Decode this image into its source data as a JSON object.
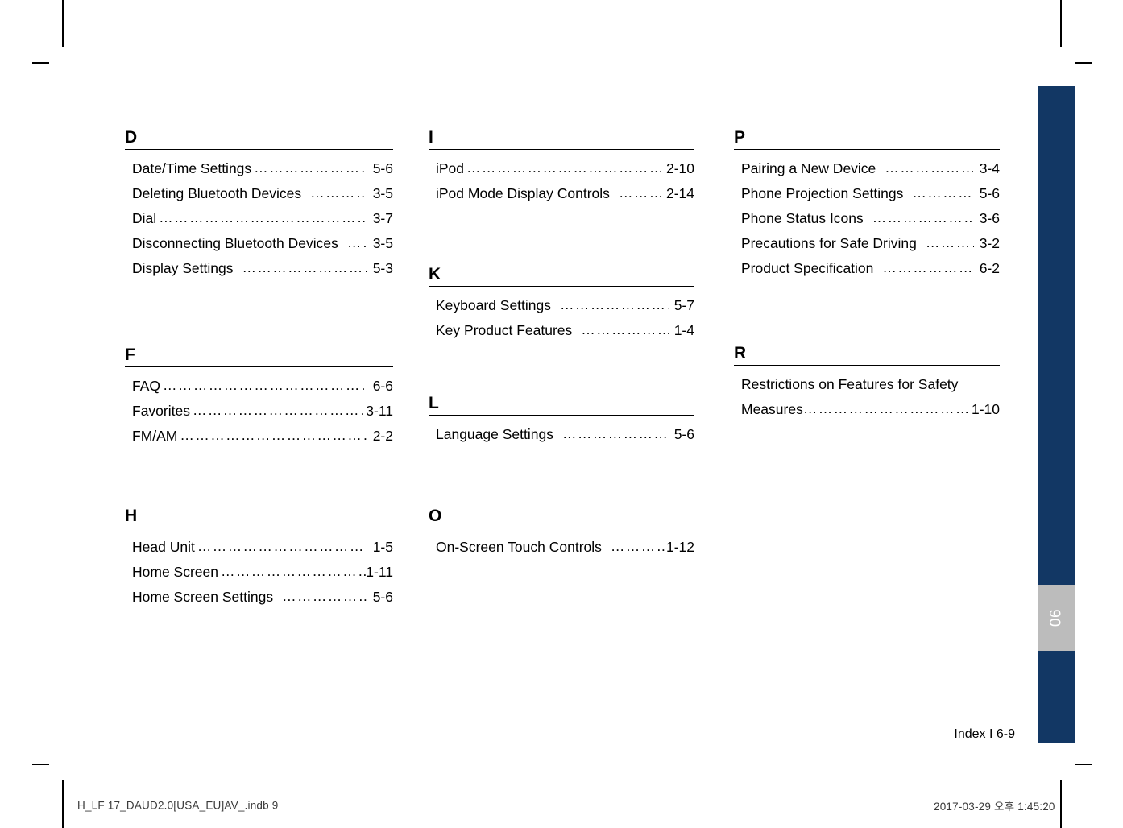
{
  "document": {
    "page_footer": "Index I 6-9",
    "chapter_tab_number": "06",
    "meta_left": "H_LF 17_DAUD2.0[USA_EU]AV_.indb   9",
    "meta_right": "2017-03-29   오후 1:45:20"
  },
  "colors": {
    "edge_bar": "#123764",
    "chapter_tab": "#bcbcbc",
    "text": "#000000"
  },
  "columns": [
    {
      "id": "column-1",
      "groups": [
        {
          "letter": "D",
          "entries": [
            {
              "title": "Date/Time Settings",
              "leader": "…………………………………………",
              "page": "5-6"
            },
            {
              "title": "Deleting Bluetooth Devices",
              "leader": "……………………………",
              "page": "3-5"
            },
            {
              "title": "Dial",
              "leader": "……………………………………………………………",
              "page": "3-7"
            },
            {
              "title": "Disconnecting Bluetooth Devices",
              "leader": "…………",
              "page": "3-5"
            },
            {
              "title": "Display Settings",
              "leader": "……………………………………",
              "page": "5-3"
            }
          ]
        },
        {
          "letter": "F",
          "entries": [
            {
              "title": "FAQ",
              "leader": "………………………………………………………",
              "page": "6-6"
            },
            {
              "title": "Favorites",
              "leader": "……………………………………………",
              "page": "3-11"
            },
            {
              "title": "FM/AM",
              "leader": "……………………………………………………",
              "page": "2-2"
            }
          ]
        },
        {
          "letter": "H",
          "entries": [
            {
              "title": "Head Unit",
              "leader": "………………………………………………",
              "page": "1-5"
            },
            {
              "title": "Home Screen",
              "leader": "……………………………………………",
              "page": "1-11"
            },
            {
              "title": "Home Screen Settings",
              "leader": "…………………………",
              "page": "5-6"
            }
          ]
        }
      ]
    },
    {
      "id": "column-2",
      "groups": [
        {
          "letter": "I",
          "entries": [
            {
              "title": "iPod",
              "leader": "…………………………………………………………",
              "page": "2-10"
            },
            {
              "title": "iPod Mode Display Controls",
              "leader": "……………",
              "page": "2-14"
            }
          ]
        },
        {
          "letter": "K",
          "entries": [
            {
              "title": "Keyboard Settings",
              "leader": "…………………………………",
              "page": "5-7"
            },
            {
              "title": "Key Product Features",
              "leader": "……………………………",
              "page": "1-4"
            }
          ]
        },
        {
          "letter": "L",
          "entries": [
            {
              "title": "Language Settings",
              "leader": "…………………………………",
              "page": "5-6"
            }
          ]
        },
        {
          "letter": "O",
          "entries": [
            {
              "title": "On-Screen Touch Controls",
              "leader": "………………",
              "page": "1-12"
            }
          ]
        }
      ]
    },
    {
      "id": "column-3",
      "groups": [
        {
          "letter": "P",
          "entries": [
            {
              "title": "Pairing a New Device",
              "leader": "……………………………",
              "page": "3-4"
            },
            {
              "title": "Phone Projection Settings",
              "leader": "………………",
              "page": "5-6"
            },
            {
              "title": "Phone Status Icons",
              "leader": "…………………………………",
              "page": "3-6"
            },
            {
              "title": "Precautions for Safe Driving",
              "leader": "……………",
              "page": "3-2"
            },
            {
              "title": "Product Specification",
              "leader": "……………………………",
              "page": "6-2"
            }
          ]
        },
        {
          "letter": "R",
          "wrapped_entry": {
            "line_1": "Restrictions on Features for Safety",
            "line_2_title": "Measures",
            "line_2_leader": "………………………………………………",
            "page": "1-10"
          }
        }
      ]
    }
  ]
}
